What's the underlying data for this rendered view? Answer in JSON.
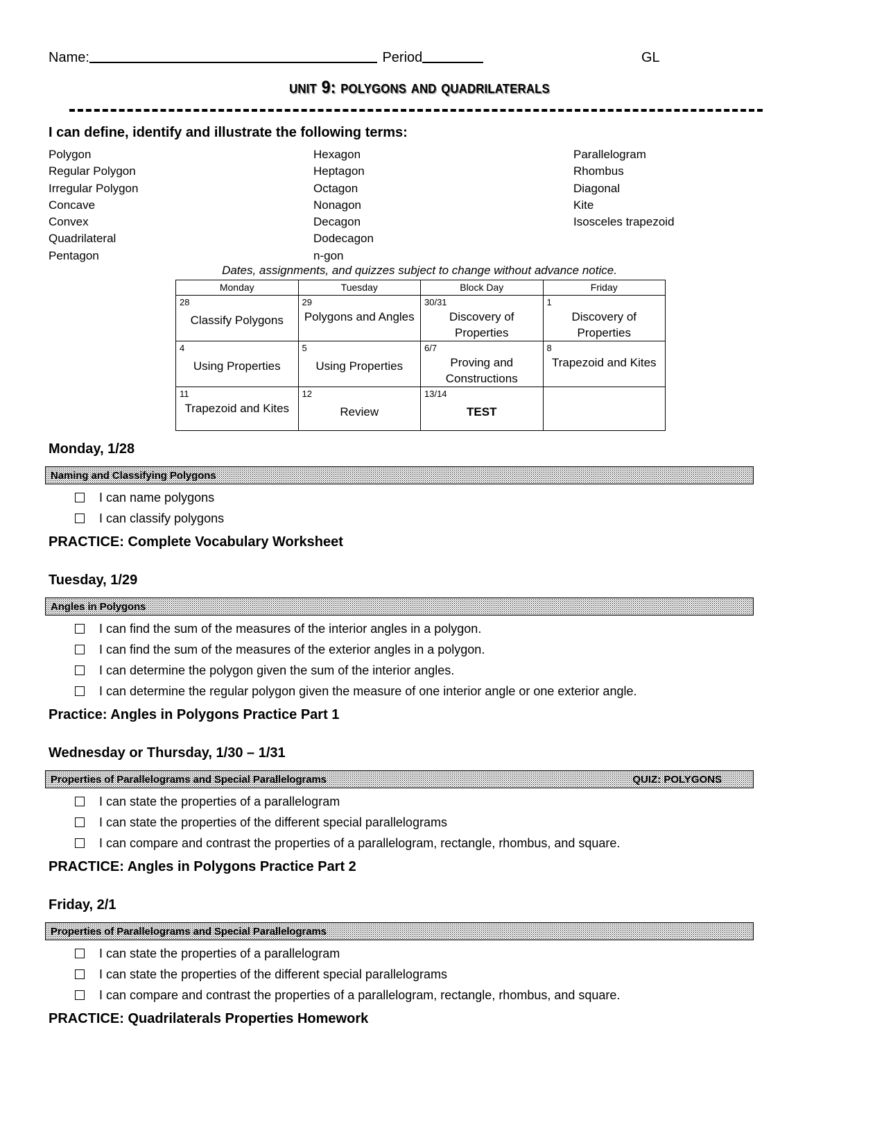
{
  "header": {
    "name_label": "Name:",
    "period_label": " Period",
    "gl_label": "GL",
    "title": "Unit 9: Polygons and Quadrilaterals"
  },
  "terms": {
    "heading": "I can define, identify and illustrate the following terms:",
    "column1": [
      "Polygon",
      "Regular Polygon",
      "Irregular Polygon",
      "Concave",
      "Convex",
      "Quadrilateral",
      "Pentagon"
    ],
    "column2": [
      "Hexagon",
      "Heptagon",
      "Octagon",
      "Nonagon",
      "Decagon",
      "Dodecagon",
      "n-gon"
    ],
    "column3": [
      "Parallelogram",
      "Rhombus",
      "Diagonal",
      "Kite",
      "Isosceles trapezoid"
    ]
  },
  "calendar": {
    "note": "Dates, assignments, and quizzes subject to change without advance notice.",
    "headers": [
      "Monday",
      "Tuesday",
      "Block Day",
      "Friday"
    ],
    "rows": [
      [
        {
          "date": "28",
          "text": "Classify Polygons"
        },
        {
          "date": "29",
          "text": "Polygons and Angles"
        },
        {
          "date": "30/31",
          "text": "Discovery of Properties"
        },
        {
          "date": "1",
          "text": "Discovery of Properties"
        }
      ],
      [
        {
          "date": "4",
          "text": "Using Properties"
        },
        {
          "date": "5",
          "text": "Using Properties"
        },
        {
          "date": "6/7",
          "text": "Proving and Constructions"
        },
        {
          "date": "8",
          "text": "Trapezoid and Kites"
        }
      ],
      [
        {
          "date": "11",
          "text": "Trapezoid and Kites"
        },
        {
          "date": "12",
          "text": "Review"
        },
        {
          "date": "13/14",
          "text": "TEST"
        },
        {
          "date": "",
          "text": ""
        }
      ]
    ]
  },
  "days": [
    {
      "heading": "Monday, 1/28",
      "bar_left": "Naming and Classifying Polygons",
      "bar_right": "",
      "objectives": [
        "I can name polygons",
        "I can classify polygons"
      ],
      "practice": "PRACTICE:  Complete Vocabulary Worksheet"
    },
    {
      "heading": "Tuesday, 1/29",
      "bar_left": "Angles in Polygons",
      "bar_right": "",
      "objectives": [
        "I can find the sum of the measures of the interior angles in a polygon.",
        "I can find the sum of the measures of the exterior angles in a polygon.",
        "I can determine the polygon given the sum of the interior angles.",
        "I can determine the regular polygon given the measure of one interior angle or one exterior angle."
      ],
      "practice": "Practice:   Angles in Polygons Practice Part 1"
    },
    {
      "heading": "Wednesday or Thursday, 1/30 – 1/31",
      "bar_left": "Properties of Parallelograms and Special Parallelograms",
      "bar_right": "QUIZ: POLYGONS",
      "objectives": [
        "I can state the properties of a parallelogram",
        "I can state the properties of the different special parallelograms",
        "I can compare and contrast the properties of a parallelogram, rectangle, rhombus, and square."
      ],
      "practice": "PRACTICE:  Angles in Polygons Practice Part 2"
    },
    {
      "heading": "Friday, 2/1",
      "bar_left": "Properties of Parallelograms and Special Parallelograms",
      "bar_right": "",
      "objectives": [
        "I can state the properties of a parallelogram",
        "I can state the properties of the different special parallelograms",
        "I can compare and contrast the properties of a parallelogram, rectangle, rhombus, and square."
      ],
      "practice": "PRACTICE:  Quadrilaterals Properties Homework"
    }
  ]
}
